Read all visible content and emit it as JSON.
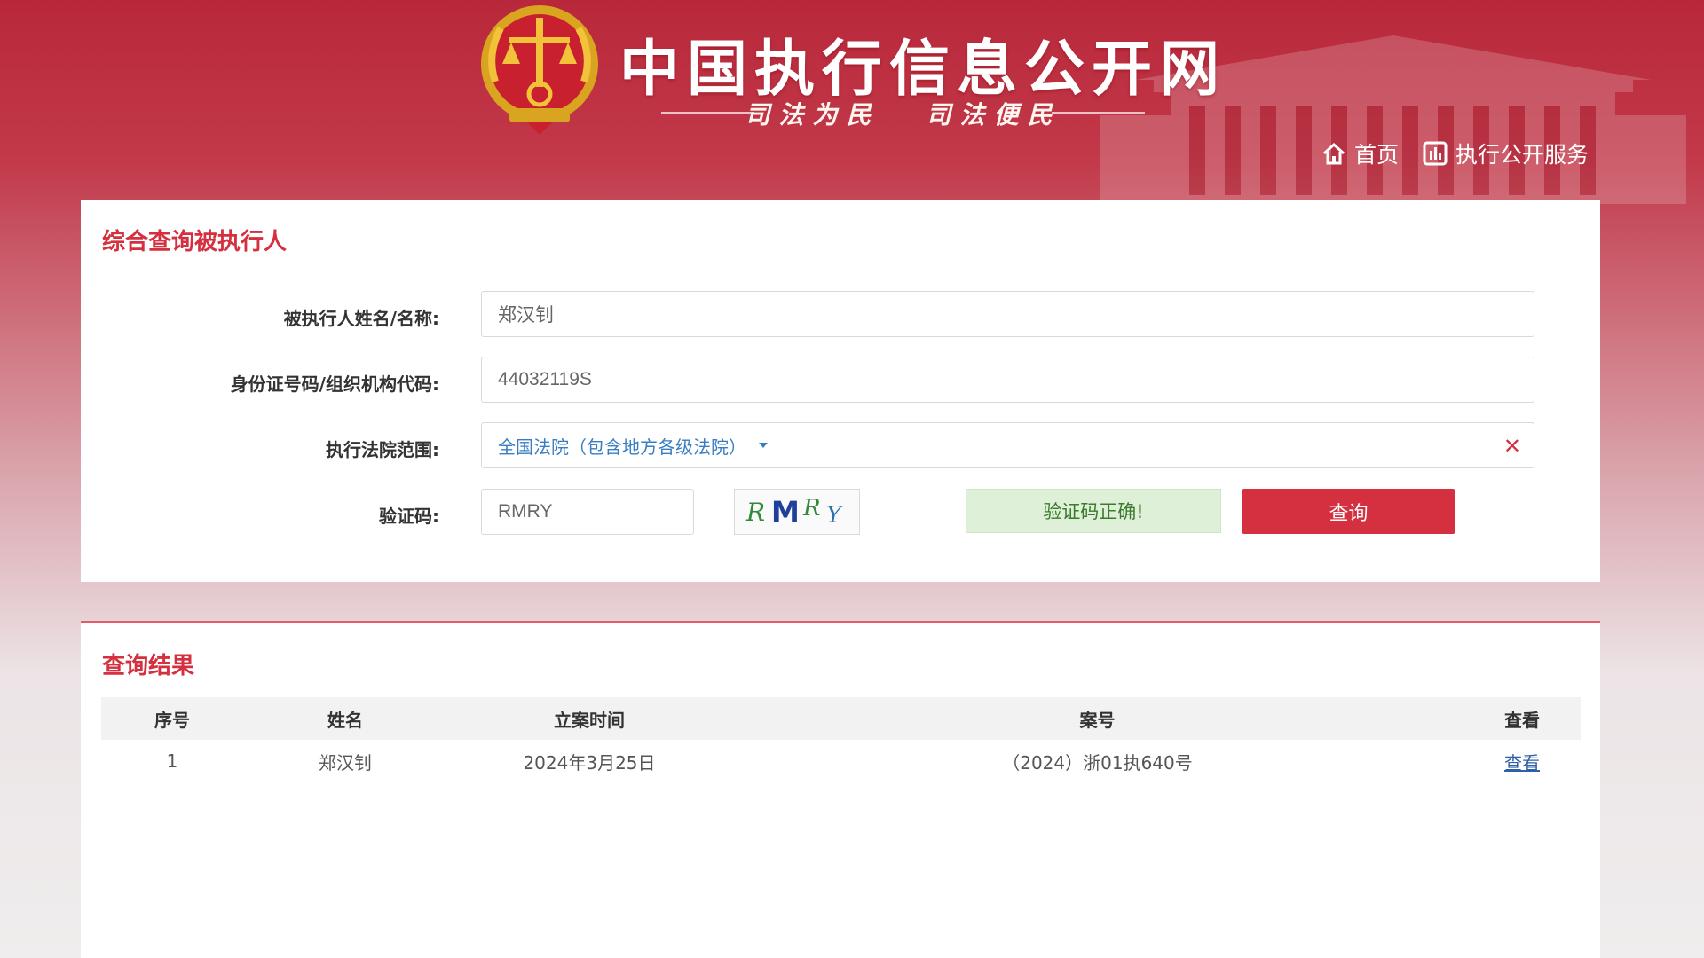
{
  "header": {
    "site_title": "中国执行信息公开网",
    "slogan_left": "司法为民",
    "slogan_right": "司法便民",
    "nav": [
      {
        "icon": "home-icon",
        "label": "首页"
      },
      {
        "icon": "chart-icon",
        "label": "执行公开服务"
      }
    ]
  },
  "search": {
    "title": "综合查询被执行人",
    "name_label": "被执行人姓名/名称:",
    "name_value": "郑汉钊",
    "id_label": "身份证号码/组织机构代码:",
    "id_value": "44032119S",
    "court_label": "执行法院范围:",
    "court_value": "全国法院（包含地方各级法院）",
    "captcha_label": "验证码:",
    "captcha_value": "RMRY",
    "captcha_image_text": "RMRY",
    "captcha_status": "验证码正确!",
    "query_button": "查询"
  },
  "results": {
    "title": "查询结果",
    "columns": [
      "序号",
      "姓名",
      "立案时间",
      "案号",
      "查看"
    ],
    "rows": [
      {
        "index": "1",
        "name": "郑汉钊",
        "date": "2024年3月25日",
        "case_no": "（2024）浙01执640号",
        "view": "查看"
      }
    ]
  },
  "colors": {
    "brand_red": "#d4303f",
    "link_blue": "#2f5fa8",
    "success_bg": "#dff0d8"
  }
}
